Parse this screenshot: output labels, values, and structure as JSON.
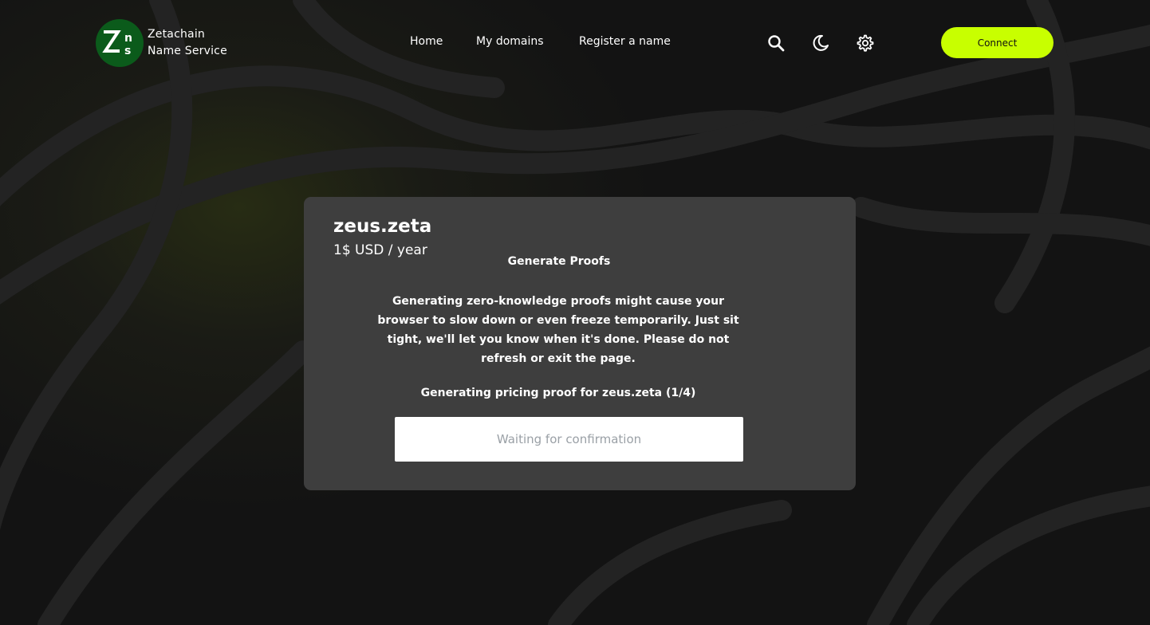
{
  "header": {
    "logo_line1": "Zetachain",
    "logo_line2": "Name Service",
    "nav": [
      "Home",
      "My domains",
      "Register a name"
    ],
    "icons": [
      "search-icon",
      "moon-icon",
      "gear-icon"
    ],
    "connect_label": "Connect"
  },
  "card": {
    "domain": "zeus.zeta",
    "price": "1$ USD / year"
  },
  "modal": {
    "title": "Generate Proofs",
    "description": "Generating zero-knowledge proofs might cause your browser to slow down or even freeze temporarily. Just sit tight, we'll let you know when it's done. Please do not refresh or exit the page.",
    "status": "Generating pricing proof for zeus.zeta  (1/4)",
    "waiting": "Waiting for confirmation"
  },
  "colors": {
    "accent": "#c8ff00",
    "logo_bg": "#0b5b1b",
    "card_bg": "#3e3e3e",
    "page_bg": "#131313"
  }
}
